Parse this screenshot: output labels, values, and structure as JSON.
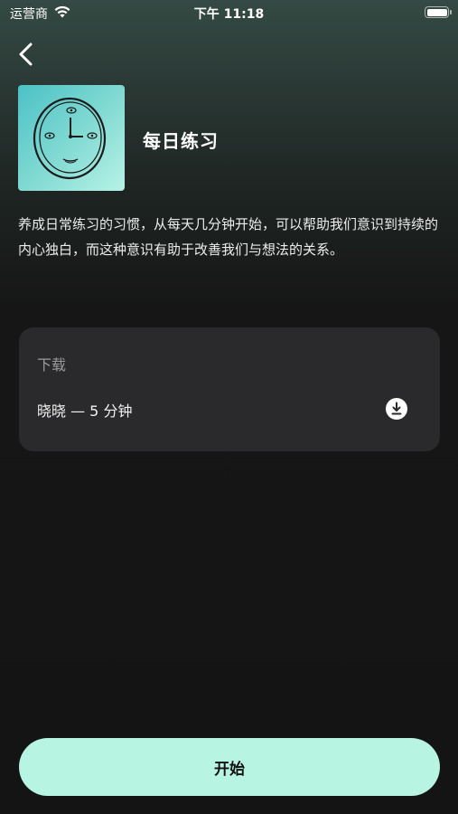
{
  "status_bar": {
    "carrier": "运营商",
    "time": "下午 11:18",
    "battery_level": 1.0
  },
  "header": {
    "back_icon": "chevron-left-icon"
  },
  "session": {
    "title": "每日练习",
    "cover_icon": "clock-face-illustration",
    "description": "养成日常练习的习惯，从每天几分钟开始，可以帮助我们意识到持续的内心独白，而这种意识有助于改善我们与想法的关系。"
  },
  "download": {
    "heading": "下载",
    "items": [
      {
        "label": "晓晓 — 5 分钟",
        "icon": "download-icon"
      }
    ]
  },
  "footer": {
    "start_label": "开始",
    "accent": "#b8f4e2"
  }
}
